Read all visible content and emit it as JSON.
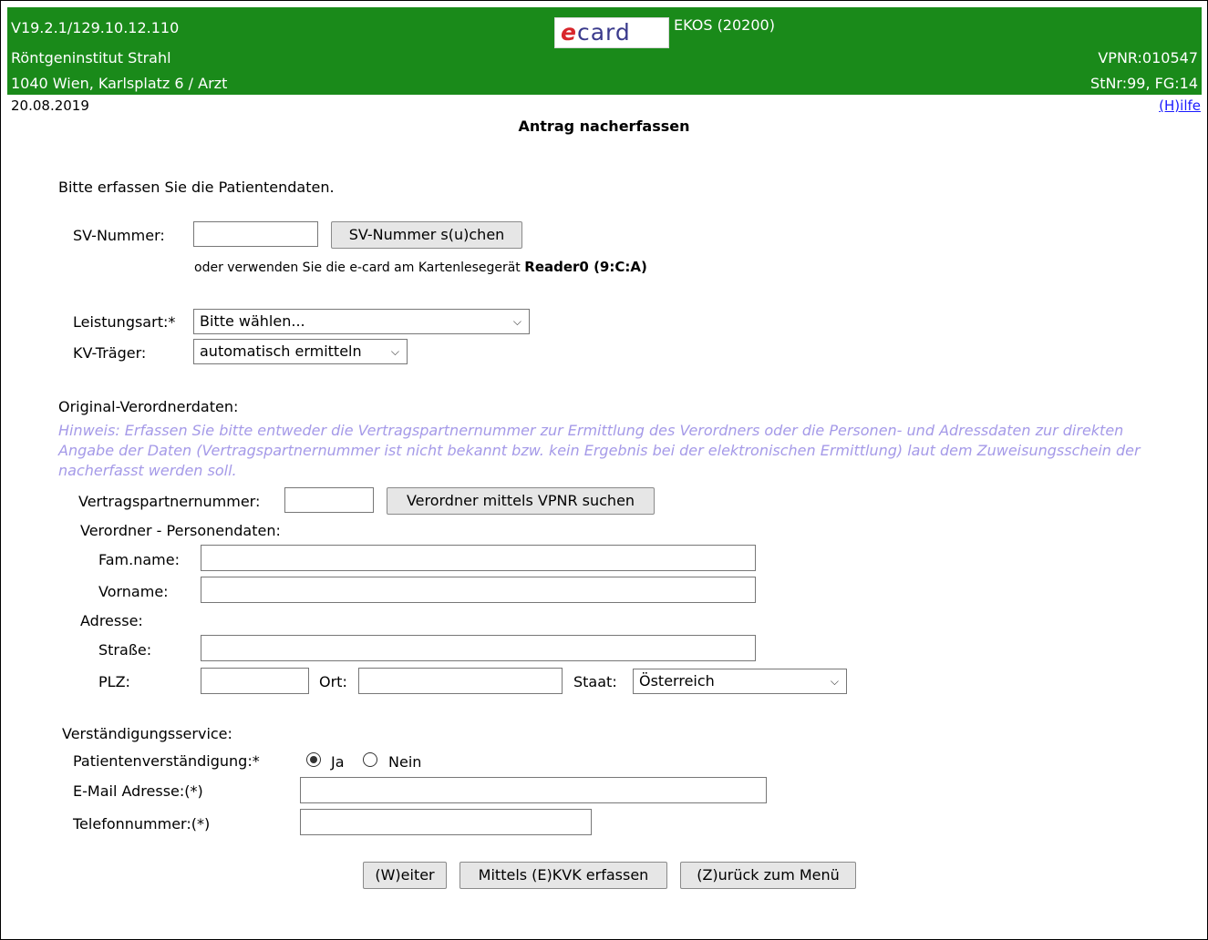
{
  "header": {
    "version": "V19.2.1/129.10.12.110",
    "logo_e": "e",
    "logo_card": "card",
    "system": "EKOS (20200)",
    "institute": "Röntgeninstitut Strahl",
    "vpnr": "VPNR:010547",
    "address": "1040 Wien, Karlsplatz 6 / Arzt",
    "station": "StNr:99, FG:14"
  },
  "date": "20.08.2019",
  "help_link": "(H)ilfe",
  "page_title": "Antrag nacherfassen",
  "intro": "Bitte erfassen Sie die Patientendaten.",
  "sv": {
    "label": "SV-Nummer:",
    "value": "",
    "search_button": "SV-Nummer s(u)chen",
    "card_hint_prefix": "oder verwenden Sie die e-card am Kartenlesegerät",
    "card_reader": "Reader0 (9:C:A)"
  },
  "leistungsart": {
    "label": "Leistungsart:*",
    "selected": "Bitte wählen..."
  },
  "kv_traeger": {
    "label": "KV-Träger:",
    "selected": "automatisch ermitteln"
  },
  "verordner": {
    "section_label": "Original-Verordnerdaten:",
    "hint": "Hinweis: Erfassen Sie bitte entweder die Vertragspartnernummer zur Ermittlung des Verordners oder die Personen- und Adressdaten zur direkten Angabe der Daten (Vertragspartnernummer ist nicht bekannt bzw. kein Ergebnis bei der elektronischen Ermittlung) laut dem Zuweisungsschein der nacherfasst werden soll.",
    "vpnr_label": "Vertragspartnernummer:",
    "vpnr_value": "",
    "vpnr_button": "Verordner mittels VPNR suchen",
    "person_label": "Verordner - Personendaten:",
    "famname_label": "Fam.name:",
    "famname_value": "",
    "vorname_label": "Vorname:",
    "vorname_value": "",
    "address_label": "Adresse:",
    "strasse_label": "Straße:",
    "strasse_value": "",
    "plz_label": "PLZ:",
    "plz_value": "",
    "ort_label": "Ort:",
    "ort_value": "",
    "staat_label": "Staat:",
    "staat_selected": "Österreich"
  },
  "service": {
    "section_label": "Verständigungsservice:",
    "notify_label": "Patientenverständigung:*",
    "option_yes": "Ja",
    "option_no": "Nein",
    "selected": "Ja",
    "email_label": "E-Mail Adresse:(*)",
    "email_value": "",
    "phone_label": "Telefonnummer:(*)",
    "phone_value": ""
  },
  "buttons": {
    "next": "(W)eiter",
    "ekvk": "Mittels (E)KVK erfassen",
    "back": "(Z)urück zum Menü"
  },
  "colors": {
    "header_bg": "#1a8a1a",
    "hint": "#a59ae8",
    "link": "#1a1aff"
  }
}
